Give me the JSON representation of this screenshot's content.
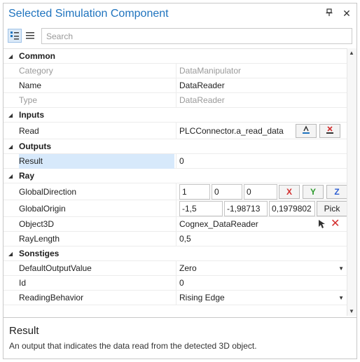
{
  "window": {
    "title": "Selected Simulation Component"
  },
  "toolbar": {
    "search_placeholder": "Search"
  },
  "categories": {
    "common": "Common",
    "inputs": "Inputs",
    "outputs": "Outputs",
    "ray": "Ray",
    "sonstiges": "Sonstiges"
  },
  "props": {
    "category": {
      "name": "Category",
      "value": "DataManipulator"
    },
    "name": {
      "name": "Name",
      "value": "DataReader"
    },
    "type": {
      "name": "Type",
      "value": "DataReader"
    },
    "read": {
      "name": "Read",
      "value": "PLCConnector.a_read_data"
    },
    "result": {
      "name": "Result",
      "value": "0"
    },
    "global_direction": {
      "name": "GlobalDirection",
      "x": "1",
      "y": "0",
      "z": "0",
      "btn_x": "X",
      "btn_y": "Y",
      "btn_z": "Z"
    },
    "global_origin": {
      "name": "GlobalOrigin",
      "x": "-1,5",
      "y": "-1,98713",
      "z": "0,1979802",
      "pick": "Pick"
    },
    "object3d": {
      "name": "Object3D",
      "value": "Cognex_DataReader"
    },
    "ray_length": {
      "name": "RayLength",
      "value": "0,5"
    },
    "default_output": {
      "name": "DefaultOutputValue",
      "value": "Zero"
    },
    "id": {
      "name": "Id",
      "value": "0"
    },
    "reading_behavior": {
      "name": "ReadingBehavior",
      "value": "Rising Edge"
    }
  },
  "description": {
    "title": "Result",
    "text": "An output that indicates the data read from the detected 3D object."
  },
  "colors": {
    "title": "#1e73be",
    "axis_x": "#d32f2f",
    "axis_y": "#2e9b2e",
    "axis_z": "#2f5fd3",
    "selection": "#d7e9fb"
  }
}
